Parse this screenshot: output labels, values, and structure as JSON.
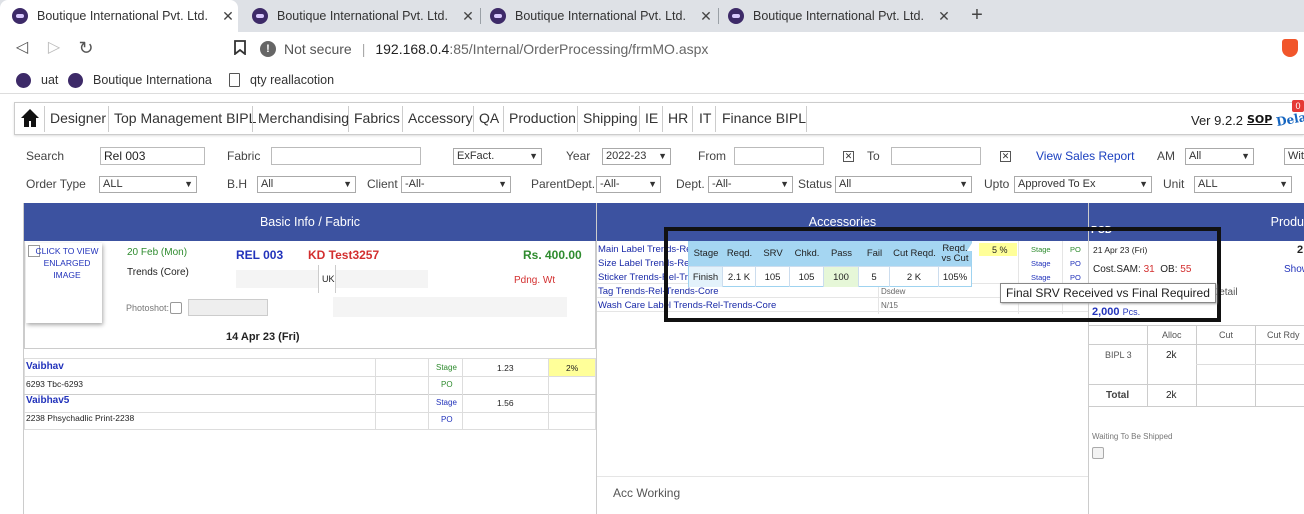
{
  "browser": {
    "tabs": [
      {
        "title": "Boutique International Pvt. Ltd."
      },
      {
        "title": "Boutique International Pvt. Ltd."
      },
      {
        "title": "Boutique International Pvt. Ltd."
      },
      {
        "title": "Boutique International Pvt. Ltd."
      }
    ],
    "address": {
      "security": "Not secure",
      "host": "192.168.0.4",
      "path": ":85/Internal/OrderProcessing/frmMO.aspx"
    },
    "bookmarks": [
      {
        "label": "uat"
      },
      {
        "label": "Boutique Internationa"
      },
      {
        "label": "qty reallacotion"
      }
    ]
  },
  "menu": {
    "items": [
      "Designer",
      "Top Management BIPL",
      "Merchandising",
      "Fabrics",
      "Accessory",
      "QA",
      "Production",
      "Shipping",
      "IE",
      "HR",
      "IT",
      "Finance BIPL"
    ],
    "version": "Ver 9.2.2",
    "sop": "SOP",
    "delay": "Delay",
    "badge": "0"
  },
  "filters": {
    "search_label": "Search",
    "search_value": "Rel 003",
    "fabric_label": "Fabric",
    "fabric_value": "",
    "date_type": "ExFact.",
    "year_label": "Year",
    "year_value": "2022-23",
    "from_label": "From",
    "to_label": "To",
    "sales_report": "View Sales Report",
    "am_label": "AM",
    "am_value": "All",
    "with_value": "Wit",
    "ordertype_label": "Order Type",
    "ordertype_value": "ALL",
    "bh_label": "B.H",
    "bh_value": "All",
    "client_label": "Client",
    "client_value": "-All-",
    "parentdept_label": "ParentDept.",
    "parentdept_value": "-All-",
    "dept_label": "Dept.",
    "dept_value": "-All-",
    "status_label": "Status",
    "status_value": "All",
    "upto_label": "Upto",
    "upto_value": "Approved To Ex",
    "unit_label": "Unit",
    "unit_value": "ALL"
  },
  "basic": {
    "header": "Basic Info / Fabric",
    "image_link": "CLICK TO VIEW ENLARGED IMAGE",
    "date": "20 Feb (Mon)",
    "style": "REL 003",
    "test": "KD Test3257",
    "price": "Rs. 400.00",
    "brand": "Trends (Core)",
    "country": "UK",
    "pending": "Pdng. Wt",
    "photoshot_label": "Photoshot:",
    "delivery": "14 Apr 23 (Fri)"
  },
  "fabric_rows": [
    {
      "name": "Vaibhav",
      "detail": "6293 Tbc-6293",
      "stage": "Stage",
      "po": "PO",
      "value": "1.23",
      "pct": "2%"
    },
    {
      "name": "Vaibhav5",
      "detail": "2238 Phsychadlic Print-2238",
      "stage": "Stage",
      "po": "PO",
      "value": "1.56",
      "pct": ""
    }
  ],
  "accessories": {
    "header": "Accessories",
    "items": [
      "Main Label Trends-Rel",
      "Size Label Trends-Rel",
      "Sticker Trends-Rel-Tre",
      "Tag Trends-Rel-Trends-Core",
      "Wash Care Label Trends-Rel-Trends-Core"
    ],
    "col_a": [
      "",
      "",
      "",
      "Dsdew",
      "N/15"
    ],
    "pct": "5 %",
    "stage": "Stage",
    "po": "PO",
    "acc_working": "Acc Working"
  },
  "tooltip_table": {
    "headers": [
      "Stage",
      "Reqd.",
      "SRV",
      "Chkd.",
      "Pass",
      "Fail",
      "Cut Reqd.",
      "Reqd. vs Cut"
    ],
    "row": [
      "Finish",
      "2.1 K",
      "105",
      "105",
      "100",
      "5",
      "2 K",
      "105%"
    ]
  },
  "hover_tooltip": "Final SRV Received vs Final Required",
  "production": {
    "header": "Produ",
    "pcd": "PCD",
    "pcd_date": "21 Apr 23 (Fri)",
    "cost_sam_label": "Cost.SAM:",
    "cost_sam": "31",
    "ob_label": "OB:",
    "ob": "55",
    "show": "Show",
    "detail": "Detail",
    "qty": "2,000",
    "qty_unit": "Pcs.",
    "cols": [
      "Alloc",
      "Cut",
      "Cut Rdy"
    ],
    "unit_row": {
      "unit": "BIPL 3",
      "alloc": "2k"
    },
    "total_label": "Total",
    "total_alloc": "2k",
    "waiting": "Waiting To Be Shipped"
  }
}
